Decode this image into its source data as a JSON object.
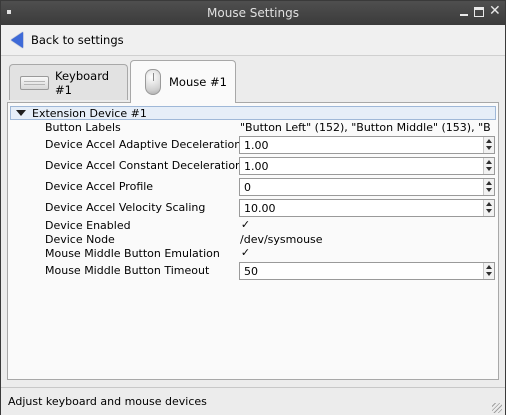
{
  "window": {
    "title": "Mouse Settings",
    "controls": {
      "minimize": "minimize",
      "maximize": "maximize",
      "close": "✕"
    }
  },
  "toolbar": {
    "back_label": "Back to settings",
    "back_icon": "back-arrow-icon"
  },
  "tabs": [
    {
      "label": "Keyboard #1",
      "icon": "keyboard-icon",
      "selected": false
    },
    {
      "label": "Mouse #1",
      "icon": "mouse-icon",
      "selected": true
    }
  ],
  "tree": {
    "group_label": "Extension Device #1",
    "properties": [
      {
        "name": "Button Labels",
        "type": "text",
        "value": "\"Button Left\" (152), \"Button Middle\" (153), \"Bu..."
      },
      {
        "name": "Device Accel Adaptive Deceleration",
        "type": "spin",
        "value": "1.00"
      },
      {
        "name": "Device Accel Constant Deceleration",
        "type": "spin",
        "value": "1.00"
      },
      {
        "name": "Device Accel Profile",
        "type": "spin",
        "value": "0"
      },
      {
        "name": "Device Accel Velocity Scaling",
        "type": "spin",
        "value": "10.00"
      },
      {
        "name": "Device Enabled",
        "type": "check",
        "value": "✓"
      },
      {
        "name": "Device Node",
        "type": "text",
        "value": "/dev/sysmouse"
      },
      {
        "name": "Mouse Middle Button Emulation",
        "type": "check",
        "value": "✓"
      },
      {
        "name": "Mouse Middle Button Timeout",
        "type": "spin",
        "value": "50"
      }
    ]
  },
  "status": {
    "text": "Adjust keyboard and mouse devices"
  }
}
